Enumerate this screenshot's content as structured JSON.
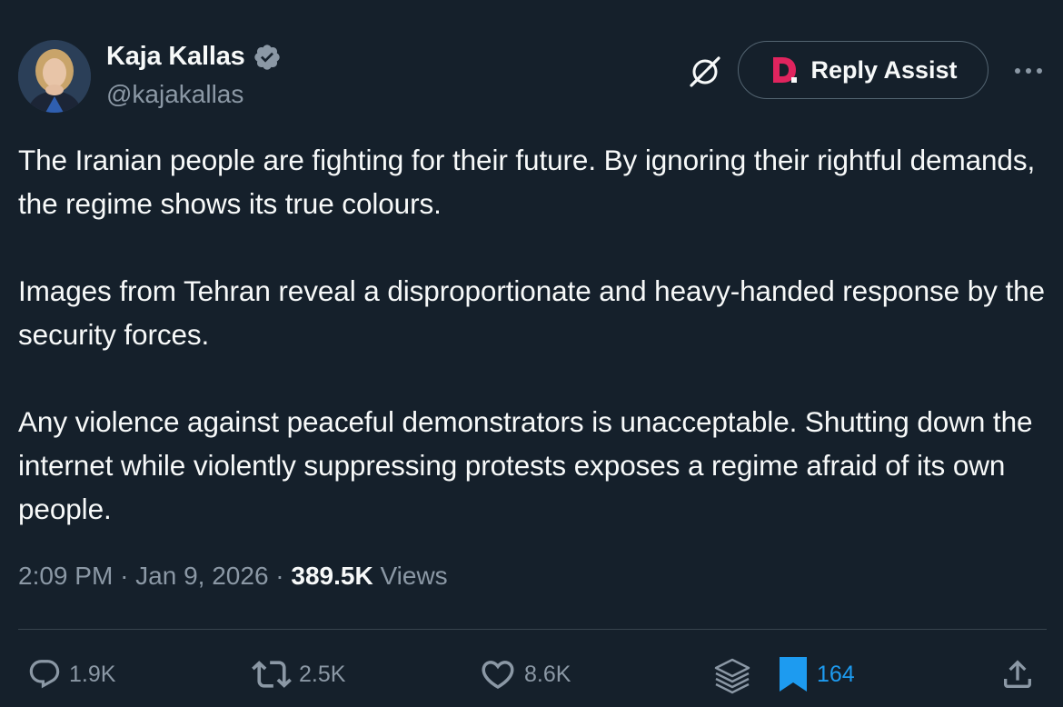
{
  "author": {
    "display_name": "Kaja Kallas",
    "handle": "@kajakallas",
    "verified": true
  },
  "header": {
    "grok_icon": "grok-slash-icon",
    "reply_assist_label": "Reply Assist",
    "reply_assist_logo_letter": "D",
    "more_icon": "more-horizontal-icon"
  },
  "tweet": {
    "paragraphs": [
      "The Iranian people are fighting for their future. By ignoring their rightful demands, the regime shows its true colours.",
      "Images from Tehran reveal a disproportionate and heavy-handed response by the security forces.",
      "Any violence against peaceful demonstrators is unacceptable. Shutting down the internet while violently suppressing protests exposes a regime afraid of its own people."
    ],
    "time": "2:09 PM",
    "separator": "·",
    "date": "Jan 9, 2026",
    "views_count": "389.5K",
    "views_label": "Views"
  },
  "actions": {
    "replies": "1.9K",
    "reposts": "2.5K",
    "likes": "8.6K",
    "bookmarks": "164"
  },
  "colors": {
    "background": "#15202b",
    "text_primary": "#f7f9f9",
    "text_secondary": "#8b98a5",
    "accent_blue": "#1d9bf0",
    "divider": "#38444d",
    "reply_assist_red": "#e0245e"
  }
}
